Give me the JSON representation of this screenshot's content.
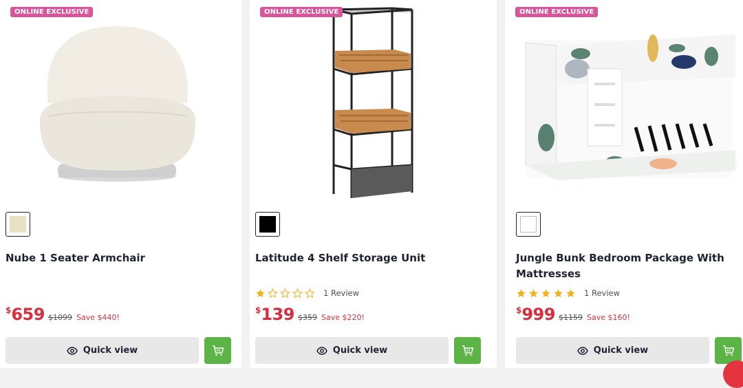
{
  "products": [
    {
      "badge": "ONLINE EXCLUSIVE",
      "name": "Nube 1 Seater Armchair",
      "swatch_color": "#e9e1c6",
      "rating": null,
      "reviews": "",
      "currency": "$",
      "price": "659",
      "was": "$1099",
      "save": "Save $440!",
      "quick_view": "Quick view"
    },
    {
      "badge": "ONLINE EXCLUSIVE",
      "name": "Latitude 4 Shelf Storage Unit",
      "swatch_color": "#000000",
      "rating": 1,
      "reviews": "1 Review",
      "currency": "$",
      "price": "139",
      "was": "$359",
      "save": "Save $220!",
      "quick_view": "Quick view"
    },
    {
      "badge": "ONLINE EXCLUSIVE",
      "name": "Jungle Bunk Bedroom Package With Mattresses",
      "swatch_color": "#ffffff",
      "rating": 5,
      "reviews": "1 Review",
      "currency": "$",
      "price": "999",
      "was": "$1159",
      "save": "Save $160!",
      "quick_view": "Quick view"
    }
  ],
  "colors": {
    "accent_price": "#d92e3e",
    "badge": "#d9549a",
    "cart": "#5cb346",
    "star": "#f2b21c"
  },
  "icons": {
    "quick_view": "eye-icon",
    "add_to_cart": "cart-icon",
    "rating": "star-icon"
  }
}
